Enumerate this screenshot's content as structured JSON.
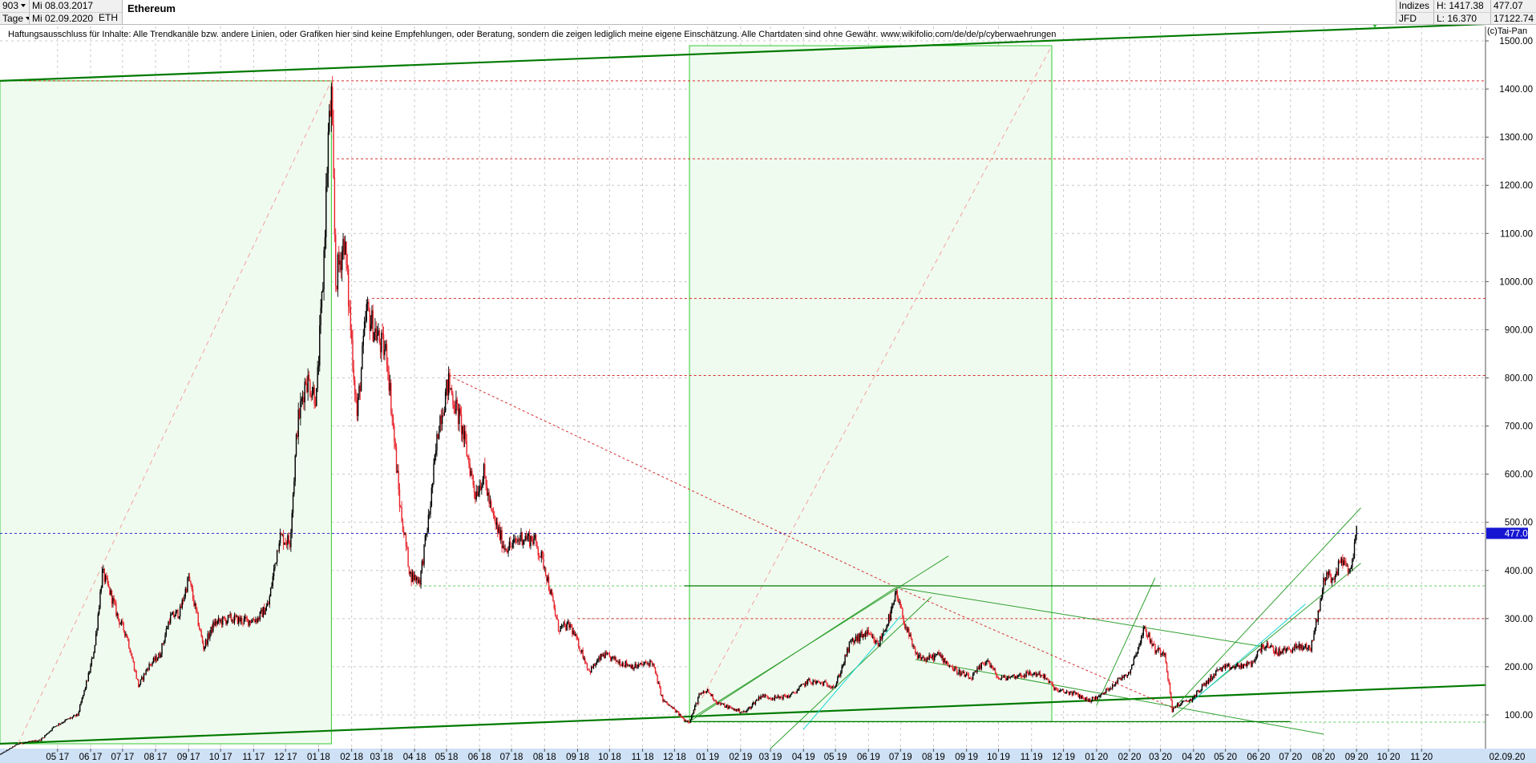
{
  "header": {
    "count": "903",
    "start_date": "Mi 08.03.2017",
    "period": "Tage",
    "end_date": "Mi 02.09.2020",
    "title": "Ethereum",
    "symbol": "ETH",
    "category": "Indizes",
    "high": "H: 1417.38",
    "price": "477.07",
    "exchange": "JFD",
    "low": "L: 16.370",
    "volume": "17122.74",
    "disclaimer": "Haftungsausschluss für Inhalte: Alle Trendkanäle bzw. andere Linien, oder Grafiken hier sind keine Empfehlungen, oder Beratung, sondern die zeigen lediglich meine eigene Einschätzung. Alle Chartdaten sind ohne Gewähr.  www.wikifolio.com/de/de/p/cyberwaehrungen",
    "copyright": "(c)Tai-Pan"
  },
  "colors": {
    "candle_up": "#000000",
    "candle_down": "#e8232c",
    "trend_main": "#007a00",
    "trend_light": "#2fa02f",
    "box_fill": "#f0fbef",
    "box_stroke": "#33cc33",
    "resistance": "#d32f2f",
    "support": "#66cc66",
    "price_line": "#3333cc",
    "price_tag": "#1616d2",
    "cyan": "#17d7d7"
  },
  "chart_data": {
    "type": "candlestick",
    "title": "Ethereum",
    "y_axis": {
      "ticks": [
        "100.00",
        "200.00",
        "300.00",
        "400.00",
        "500.00",
        "600.00",
        "700.00",
        "800.00",
        "900.00",
        "1000.00",
        "1100.00",
        "1200.00",
        "1300.00",
        "1400.00",
        "1500.00"
      ],
      "ylim": [
        30,
        1530
      ]
    },
    "x_axis": {
      "ticks": [
        "05 17",
        "06 17",
        "07 17",
        "08 17",
        "09 17",
        "10 17",
        "11 17",
        "12 17",
        "01 18",
        "02 18",
        "03 18",
        "04 18",
        "05 18",
        "06 18",
        "07 18",
        "08 18",
        "09 18",
        "10 18",
        "11 18",
        "12 18",
        "01 19",
        "02 19",
        "03 19",
        "04 19",
        "05 19",
        "06 19",
        "07 19",
        "08 19",
        "09 19",
        "10 19",
        "11 19",
        "12 19",
        "01 20",
        "02 20",
        "03 20",
        "04 20",
        "05 20",
        "06 20",
        "07 20",
        "08 20",
        "09 20",
        "10 20",
        "11 20",
        "02.09.20"
      ],
      "xlim": [
        "2017-03-08",
        "2020-12-31"
      ]
    },
    "last_price": 477.07,
    "last_price_label": "477.07",
    "series": [
      {
        "x": "2017-03-08",
        "y": 18
      },
      {
        "x": "2017-03-25",
        "y": 40
      },
      {
        "x": "2017-04-15",
        "y": 48
      },
      {
        "x": "2017-04-28",
        "y": 76
      },
      {
        "x": "2017-05-08",
        "y": 88
      },
      {
        "x": "2017-05-20",
        "y": 100
      },
      {
        "x": "2017-05-31",
        "y": 190
      },
      {
        "x": "2017-06-05",
        "y": 245
      },
      {
        "x": "2017-06-12",
        "y": 395
      },
      {
        "x": "2017-06-20",
        "y": 350
      },
      {
        "x": "2017-06-27",
        "y": 300
      },
      {
        "x": "2017-07-05",
        "y": 265
      },
      {
        "x": "2017-07-16",
        "y": 160
      },
      {
        "x": "2017-07-25",
        "y": 200
      },
      {
        "x": "2017-08-05",
        "y": 225
      },
      {
        "x": "2017-08-14",
        "y": 300
      },
      {
        "x": "2017-08-24",
        "y": 315
      },
      {
        "x": "2017-09-01",
        "y": 385
      },
      {
        "x": "2017-09-15",
        "y": 240
      },
      {
        "x": "2017-09-25",
        "y": 290
      },
      {
        "x": "2017-10-10",
        "y": 300
      },
      {
        "x": "2017-10-25",
        "y": 295
      },
      {
        "x": "2017-11-05",
        "y": 300
      },
      {
        "x": "2017-11-15",
        "y": 330
      },
      {
        "x": "2017-11-25",
        "y": 470
      },
      {
        "x": "2017-12-05",
        "y": 460
      },
      {
        "x": "2017-12-12",
        "y": 700
      },
      {
        "x": "2017-12-20",
        "y": 800
      },
      {
        "x": "2017-12-30",
        "y": 760
      },
      {
        "x": "2018-01-05",
        "y": 1000
      },
      {
        "x": "2018-01-10",
        "y": 1300
      },
      {
        "x": "2018-01-13",
        "y": 1380
      },
      {
        "x": "2018-01-17",
        "y": 1000
      },
      {
        "x": "2018-01-25",
        "y": 1090
      },
      {
        "x": "2018-02-06",
        "y": 720
      },
      {
        "x": "2018-02-15",
        "y": 940
      },
      {
        "x": "2018-02-28",
        "y": 870
      },
      {
        "x": "2018-03-06",
        "y": 850
      },
      {
        "x": "2018-03-18",
        "y": 540
      },
      {
        "x": "2018-03-28",
        "y": 390
      },
      {
        "x": "2018-04-06",
        "y": 380
      },
      {
        "x": "2018-04-15",
        "y": 520
      },
      {
        "x": "2018-04-24",
        "y": 710
      },
      {
        "x": "2018-05-03",
        "y": 790
      },
      {
        "x": "2018-05-15",
        "y": 700
      },
      {
        "x": "2018-05-28",
        "y": 560
      },
      {
        "x": "2018-06-05",
        "y": 600
      },
      {
        "x": "2018-06-12",
        "y": 520
      },
      {
        "x": "2018-06-24",
        "y": 450
      },
      {
        "x": "2018-07-01",
        "y": 450
      },
      {
        "x": "2018-07-10",
        "y": 470
      },
      {
        "x": "2018-07-22",
        "y": 465
      },
      {
        "x": "2018-08-01",
        "y": 410
      },
      {
        "x": "2018-08-14",
        "y": 280
      },
      {
        "x": "2018-08-25",
        "y": 285
      },
      {
        "x": "2018-09-05",
        "y": 230
      },
      {
        "x": "2018-09-12",
        "y": 190
      },
      {
        "x": "2018-09-25",
        "y": 225
      },
      {
        "x": "2018-10-10",
        "y": 210
      },
      {
        "x": "2018-10-25",
        "y": 200
      },
      {
        "x": "2018-11-10",
        "y": 210
      },
      {
        "x": "2018-11-20",
        "y": 130
      },
      {
        "x": "2018-12-01",
        "y": 110
      },
      {
        "x": "2018-12-10",
        "y": 90
      },
      {
        "x": "2018-12-15",
        "y": 86
      },
      {
        "x": "2018-12-24",
        "y": 140
      },
      {
        "x": "2019-01-01",
        "y": 150
      },
      {
        "x": "2019-01-10",
        "y": 125
      },
      {
        "x": "2019-01-25",
        "y": 112
      },
      {
        "x": "2019-02-05",
        "y": 105
      },
      {
        "x": "2019-02-20",
        "y": 140
      },
      {
        "x": "2019-03-05",
        "y": 135
      },
      {
        "x": "2019-03-20",
        "y": 140
      },
      {
        "x": "2019-04-05",
        "y": 170
      },
      {
        "x": "2019-04-20",
        "y": 165
      },
      {
        "x": "2019-05-01",
        "y": 160
      },
      {
        "x": "2019-05-15",
        "y": 250
      },
      {
        "x": "2019-05-30",
        "y": 270
      },
      {
        "x": "2019-06-10",
        "y": 245
      },
      {
        "x": "2019-06-22",
        "y": 310
      },
      {
        "x": "2019-06-27",
        "y": 350
      },
      {
        "x": "2019-07-05",
        "y": 290
      },
      {
        "x": "2019-07-15",
        "y": 225
      },
      {
        "x": "2019-07-25",
        "y": 215
      },
      {
        "x": "2019-08-06",
        "y": 225
      },
      {
        "x": "2019-08-20",
        "y": 195
      },
      {
        "x": "2019-09-05",
        "y": 175
      },
      {
        "x": "2019-09-20",
        "y": 215
      },
      {
        "x": "2019-10-01",
        "y": 175
      },
      {
        "x": "2019-10-15",
        "y": 180
      },
      {
        "x": "2019-10-28",
        "y": 185
      },
      {
        "x": "2019-11-10",
        "y": 185
      },
      {
        "x": "2019-11-25",
        "y": 150
      },
      {
        "x": "2019-12-10",
        "y": 145
      },
      {
        "x": "2019-12-25",
        "y": 130
      },
      {
        "x": "2020-01-05",
        "y": 140
      },
      {
        "x": "2020-01-20",
        "y": 170
      },
      {
        "x": "2020-02-01",
        "y": 190
      },
      {
        "x": "2020-02-15",
        "y": 280
      },
      {
        "x": "2020-02-25",
        "y": 235
      },
      {
        "x": "2020-03-05",
        "y": 230
      },
      {
        "x": "2020-03-12",
        "y": 110
      },
      {
        "x": "2020-03-16",
        "y": 120
      },
      {
        "x": "2020-03-30",
        "y": 132
      },
      {
        "x": "2020-04-10",
        "y": 160
      },
      {
        "x": "2020-04-25",
        "y": 195
      },
      {
        "x": "2020-05-10",
        "y": 200
      },
      {
        "x": "2020-05-25",
        "y": 205
      },
      {
        "x": "2020-06-05",
        "y": 245
      },
      {
        "x": "2020-06-20",
        "y": 230
      },
      {
        "x": "2020-07-05",
        "y": 240
      },
      {
        "x": "2020-07-20",
        "y": 240
      },
      {
        "x": "2020-07-28",
        "y": 320
      },
      {
        "x": "2020-08-02",
        "y": 390
      },
      {
        "x": "2020-08-12",
        "y": 385
      },
      {
        "x": "2020-08-18",
        "y": 430
      },
      {
        "x": "2020-08-25",
        "y": 390
      },
      {
        "x": "2020-09-01",
        "y": 477
      }
    ],
    "horizontal_levels": [
      {
        "y": 1417,
        "color": "#d32f2f",
        "style": "dash",
        "from": "2017-03-08"
      },
      {
        "y": 1255,
        "color": "#d32f2f",
        "style": "dash",
        "from": "2018-01-18"
      },
      {
        "y": 965,
        "color": "#d32f2f",
        "style": "dash",
        "from": "2018-02-20"
      },
      {
        "y": 805,
        "color": "#d32f2f",
        "style": "dash",
        "from": "2018-05-03"
      },
      {
        "y": 477,
        "color": "#3333cc",
        "style": "dash",
        "from": "2017-03-08"
      },
      {
        "y": 368,
        "color": "#66cc66",
        "style": "dash",
        "from": "2018-04-01"
      },
      {
        "y": 300,
        "color": "#d32f2f",
        "style": "dash",
        "from": "2018-09-01"
      },
      {
        "y": 85,
        "color": "#66cc66",
        "style": "dash",
        "from": "2018-12-10"
      }
    ],
    "trend_lines": [
      {
        "x1": "2017-03-08",
        "y1": 1417,
        "x2": "2020-12-31",
        "y2": 1535,
        "color": "#007a00",
        "width": 2.2
      },
      {
        "x1": "2017-03-08",
        "y1": 40,
        "x2": "2020-12-31",
        "y2": 162,
        "color": "#007a00",
        "width": 2.2
      },
      {
        "x1": "2018-05-03",
        "y1": 805,
        "x2": "2019-06-27",
        "y2": 365,
        "color": "#d32f2f",
        "width": 1,
        "dash": "3,3"
      },
      {
        "x1": "2019-06-27",
        "y1": 365,
        "x2": "2020-03-12",
        "y2": 115,
        "color": "#d32f2f",
        "width": 1,
        "dash": "3,3"
      },
      {
        "x1": "2017-03-25",
        "y1": 40,
        "x2": "2018-01-13",
        "y2": 1417,
        "color": "#f4a0a0",
        "width": 1,
        "dash": "6,5"
      },
      {
        "x1": "2018-12-15",
        "y1": 86,
        "x2": "2019-11-20",
        "y2": 1490,
        "color": "#f4a0a0",
        "width": 1,
        "dash": "6,5"
      },
      {
        "x1": "2018-12-15",
        "y1": 86,
        "x2": "2019-06-27",
        "y2": 365,
        "color": "#2fa02f",
        "width": 1
      },
      {
        "x1": "2019-03-01",
        "y1": 30,
        "x2": "2019-07-30",
        "y2": 345,
        "color": "#2fa02f",
        "width": 1
      },
      {
        "x1": "2018-12-15",
        "y1": 90,
        "x2": "2019-08-15",
        "y2": 430,
        "color": "#2fa02f",
        "width": 1
      },
      {
        "x1": "2019-06-27",
        "y1": 365,
        "x2": "2020-06-10",
        "y2": 240,
        "color": "#2fa02f",
        "width": 1
      },
      {
        "x1": "2019-07-15",
        "y1": 215,
        "x2": "2020-08-01",
        "y2": 60,
        "color": "#2fa02f",
        "width": 1
      },
      {
        "x1": "2020-03-12",
        "y1": 95,
        "x2": "2020-09-05",
        "y2": 415,
        "color": "#2fa02f",
        "width": 1
      },
      {
        "x1": "2020-03-12",
        "y1": 110,
        "x2": "2020-09-05",
        "y2": 530,
        "color": "#2fa02f",
        "width": 1
      },
      {
        "x1": "2020-01-01",
        "y1": 120,
        "x2": "2020-02-25",
        "y2": 385,
        "color": "#2fa02f",
        "width": 1
      },
      {
        "x1": "2019-04-01",
        "y1": 70,
        "x2": "2019-07-01",
        "y2": 305,
        "color": "#17d7d7",
        "width": 1
      },
      {
        "x1": "2020-04-01",
        "y1": 130,
        "x2": "2020-07-15",
        "y2": 330,
        "color": "#17d7d7",
        "width": 1
      },
      {
        "x1": "2018-12-10",
        "y1": 368,
        "x2": "2020-03-01",
        "y2": 368,
        "color": "#007a00",
        "width": 1.2
      },
      {
        "x1": "2018-12-10",
        "y1": 86,
        "x2": "2020-07-01",
        "y2": 86,
        "color": "#007a00",
        "width": 1.2
      }
    ],
    "boxes": [
      {
        "x1": "2017-03-08",
        "y1": 40,
        "x2": "2018-01-13",
        "y2": 1417
      },
      {
        "x1": "2018-12-15",
        "y1": 86,
        "x2": "2019-11-20",
        "y2": 1490
      }
    ]
  }
}
